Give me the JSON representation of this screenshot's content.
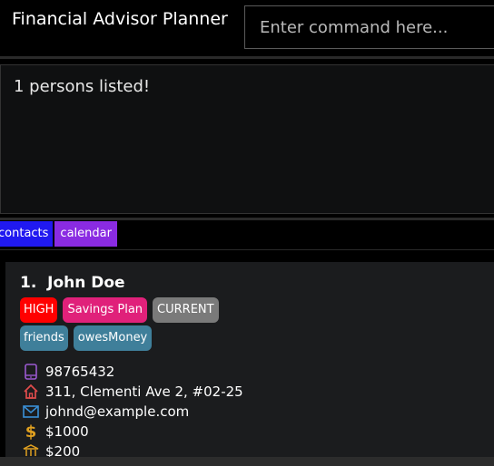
{
  "app": {
    "title": "Financial Advisor Planner"
  },
  "command": {
    "placeholder": "Enter command here..."
  },
  "result": {
    "text": "1 persons listed!"
  },
  "tabs": [
    {
      "label": "contacts",
      "color": "#2019f0"
    },
    {
      "label": "calendar",
      "color": "#8a2be2"
    }
  ],
  "person": {
    "index": "1.",
    "name": "John Doe",
    "priority_tag": {
      "label": "HIGH",
      "color": "#ff0000"
    },
    "plan_tag": {
      "label": "Savings Plan",
      "color": "#e0217a"
    },
    "status_tag": {
      "label": "CURRENT",
      "color": "#7a7a7a"
    },
    "tags": [
      {
        "label": "friends",
        "color": "#3f7f9a"
      },
      {
        "label": "owesMoney",
        "color": "#3f7f9a"
      }
    ],
    "phone": "98765432",
    "address": "311, Clementi Ave 2, #02-25",
    "email": "johnd@example.com",
    "income": "$1000",
    "monthly": "$200"
  },
  "icons": {
    "phone": "phone-icon",
    "address": "house-icon",
    "email": "mail-icon",
    "income": "dollar-icon",
    "monthly": "bank-icon"
  }
}
